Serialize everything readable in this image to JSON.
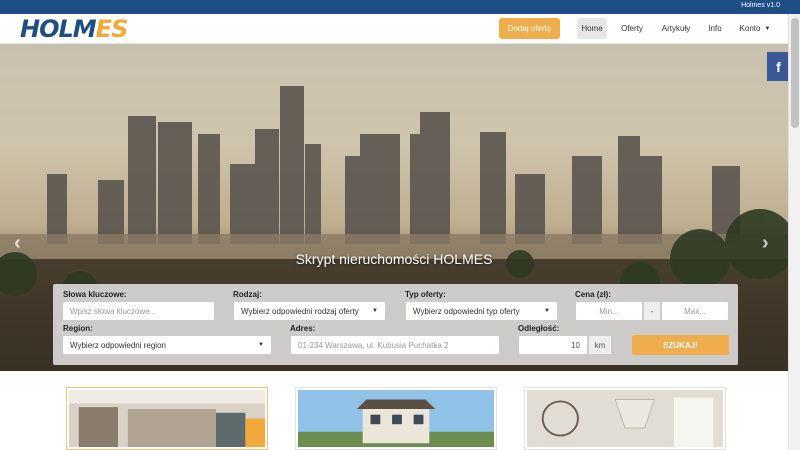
{
  "topbar": {
    "version": "Holmes v1.0"
  },
  "navbar": {
    "logo_part1": "HOLM",
    "logo_part2": "ES",
    "add_offer_label": "Dodaj ofertę",
    "items": [
      {
        "label": "Home",
        "active": true
      },
      {
        "label": "Oferty"
      },
      {
        "label": "Artykuły"
      },
      {
        "label": "Info"
      },
      {
        "label": "Konto"
      }
    ]
  },
  "hero": {
    "title": "Skrypt nieruchomości HOLMES",
    "prev_label": "‹",
    "next_label": "›",
    "social_label": "f"
  },
  "search": {
    "keywords_label": "Słowa kluczowe:",
    "keywords_placeholder": "Wpisz słowa kluczowe...",
    "type_label": "Rodzaj:",
    "type_value": "Wybierz odpowiedni rodzaj oferty",
    "offer_type_label": "Typ oferty:",
    "offer_type_value": "Wybierz odpowiedni typ oferty",
    "price_label": "Cena (zł):",
    "price_min_placeholder": "Min...",
    "price_separator": "-",
    "price_max_placeholder": "Max...",
    "region_label": "Region:",
    "region_value": "Wybierz odpowiedni region",
    "address_label": "Adres:",
    "address_placeholder": "01-234 Warszawa, ul. Kubusia Puchatka 2",
    "distance_label": "Odległość:",
    "distance_value": "10",
    "distance_unit": "km",
    "submit_label": "SZUKAJ!"
  },
  "colors": {
    "brand_blue": "#1f4e84",
    "accent_orange": "#f0ad4e",
    "facebook_blue": "#3b5998"
  }
}
